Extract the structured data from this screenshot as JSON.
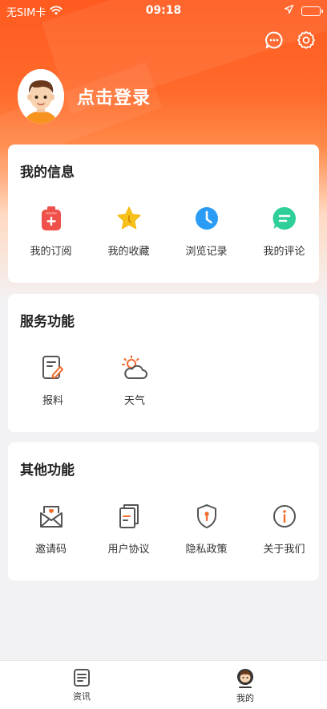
{
  "status_bar": {
    "carrier": "无SIM卡",
    "time": "09:18",
    "wifi_icon": "wifi-icon",
    "location_icon": "location-arrow-icon",
    "battery_icon": "battery-icon"
  },
  "header": {
    "message_icon": "chat-bubble-icon",
    "settings_icon": "gear-icon",
    "login_label": "点击登录",
    "avatar_icon": "cartoon-avatar-icon"
  },
  "sections": [
    {
      "title": "我的信息",
      "items": [
        {
          "label": "我的订阅",
          "icon": "subscription-icon",
          "color": "#f0504a"
        },
        {
          "label": "我的收藏",
          "icon": "star-icon",
          "color": "#f7c21b"
        },
        {
          "label": "浏览记录",
          "icon": "clock-icon",
          "color": "#2a9cf5"
        },
        {
          "label": "我的评论",
          "icon": "comment-icon",
          "color": "#2fcf9a"
        }
      ]
    },
    {
      "title": "服务功能",
      "items": [
        {
          "label": "报料",
          "icon": "edit-document-icon"
        },
        {
          "label": "天气",
          "icon": "weather-icon"
        }
      ]
    },
    {
      "title": "其他功能",
      "items": [
        {
          "label": "邀请码",
          "icon": "invite-envelope-icon"
        },
        {
          "label": "用户协议",
          "icon": "agreement-document-icon"
        },
        {
          "label": "隐私政策",
          "icon": "privacy-shield-icon"
        },
        {
          "label": "关于我们",
          "icon": "info-icon"
        }
      ]
    }
  ],
  "tabbar": {
    "tabs": [
      {
        "label": "资讯",
        "icon": "news-icon"
      },
      {
        "label": "我的",
        "icon": "profile-tab-icon"
      }
    ]
  },
  "colors": {
    "brand": "#ff5a1f",
    "accent_icon": "#f06a2a",
    "icon_gray": "#555555"
  }
}
